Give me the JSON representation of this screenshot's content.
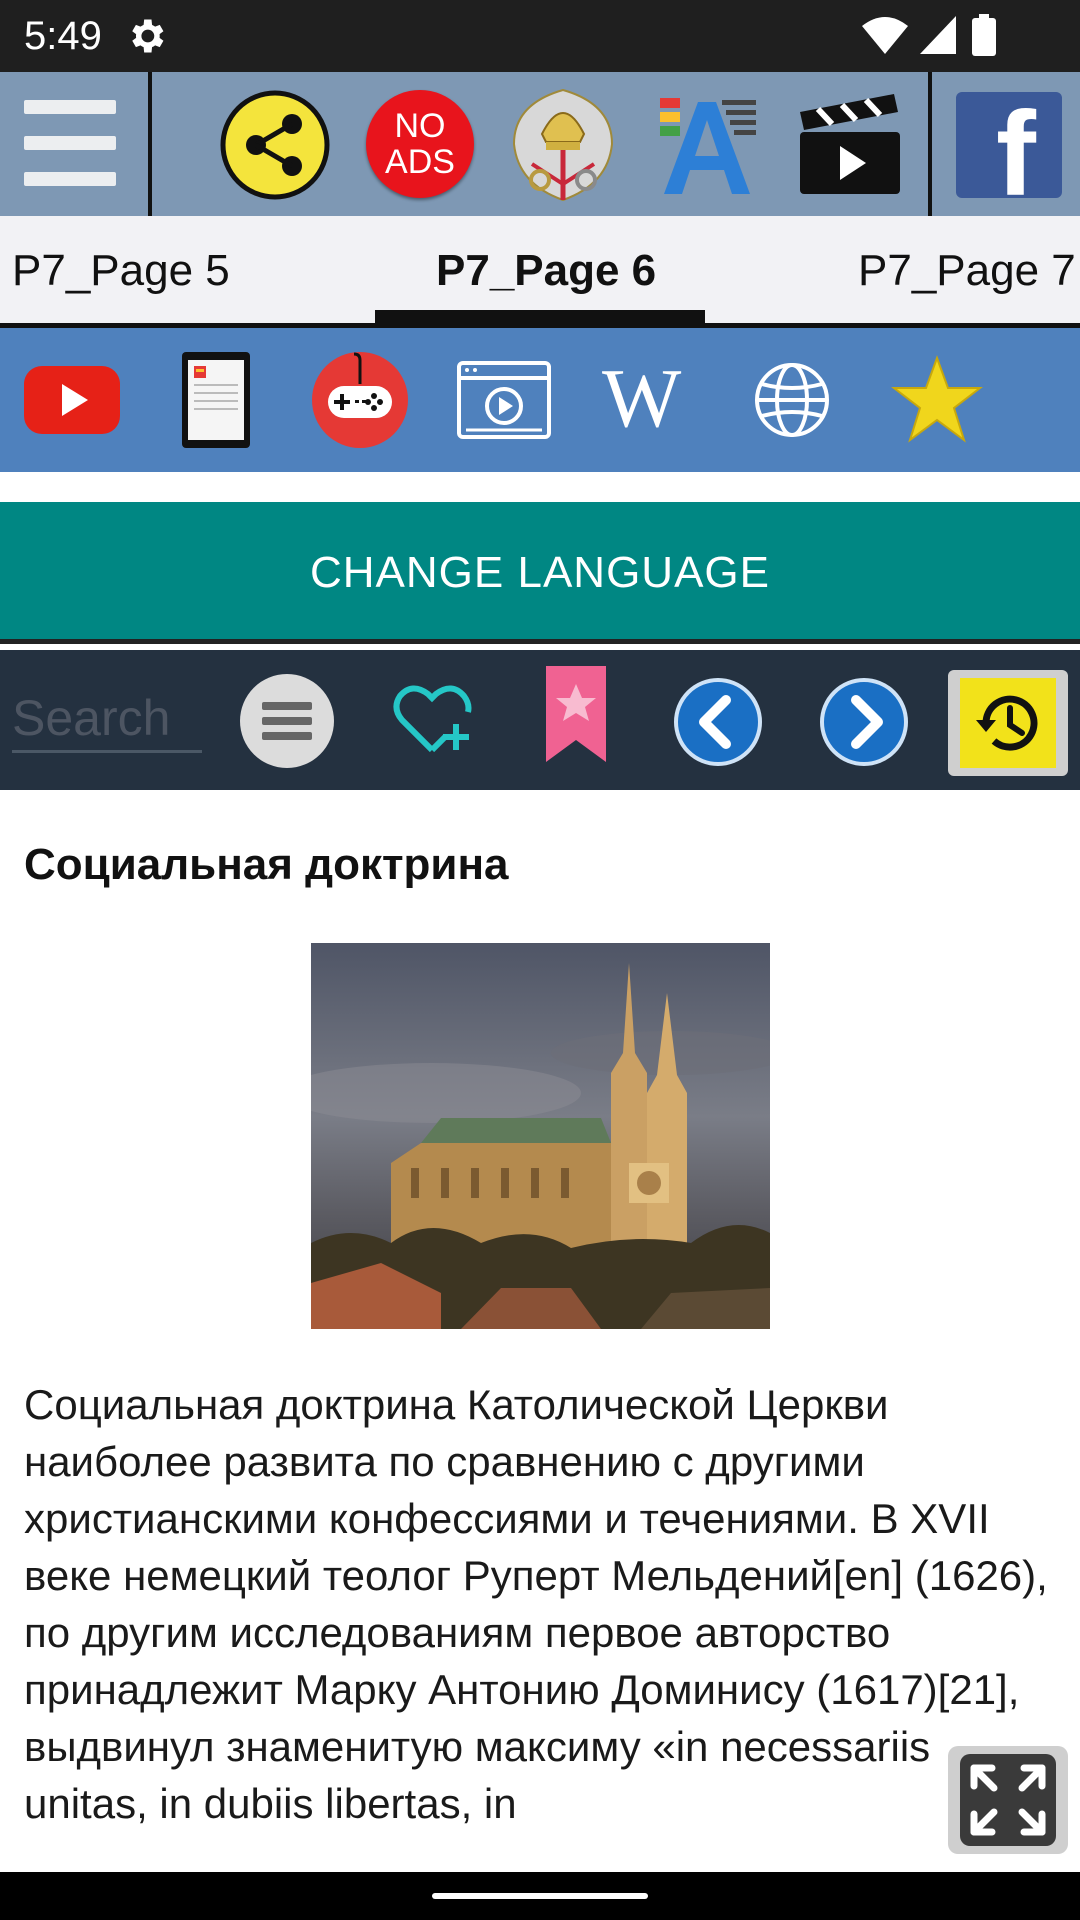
{
  "status_bar": {
    "time": "5:49",
    "icons": [
      "settings-gear-icon",
      "wifi-icon",
      "cell-signal-icon",
      "battery-icon"
    ]
  },
  "toolbar": {
    "icons": [
      "hamburger-menu-icon",
      "share-icon",
      "no-ads-icon",
      "vatican-emblem-icon",
      "font-size-icon",
      "video-clapper-icon",
      "facebook-icon"
    ],
    "no_ads_line1": "NO",
    "no_ads_line2": "ADS",
    "facebook_letter": "f"
  },
  "tabs": {
    "items": [
      {
        "label": "P7_Page 5",
        "active": false
      },
      {
        "label": "P7_Page 6",
        "active": true
      },
      {
        "label": "P7_Page 7",
        "active": false
      }
    ]
  },
  "links_row": {
    "icons": [
      "youtube-icon",
      "ebook-reader-icon",
      "games-icon",
      "video-player-icon",
      "wikipedia-icon",
      "globe-icon",
      "star-icon"
    ],
    "wiki_letter": "W"
  },
  "change_language": {
    "label": "CHANGE LANGUAGE"
  },
  "search_row": {
    "placeholder": "Search",
    "icons": [
      "list-menu-icon",
      "add-favorite-icon",
      "bookmark-icon",
      "previous-arrow-icon",
      "next-arrow-icon",
      "history-icon"
    ]
  },
  "article": {
    "title": "Социальная доктрина",
    "body": "Социальная доктрина Католической Церкви наиболее развита по сравнению с другими христианскими конфессиями и течениями. В XVII веке немецкий теолог Руперт Мельдений[en] (1626), по другим исследованиям первое авторство принадлежит Марку Антонию Доминису (1617)[21], выдвинул знаменитую максиму «in necessariis unitas, in dubiis libertas, in",
    "image_subject": "cathedral-photo"
  },
  "colors": {
    "toolbar_bg": "#7e98b4",
    "links_bg": "#4f81bd",
    "language_bg": "#008783",
    "search_bg": "#243140",
    "status_bg": "#1f1f1f"
  }
}
